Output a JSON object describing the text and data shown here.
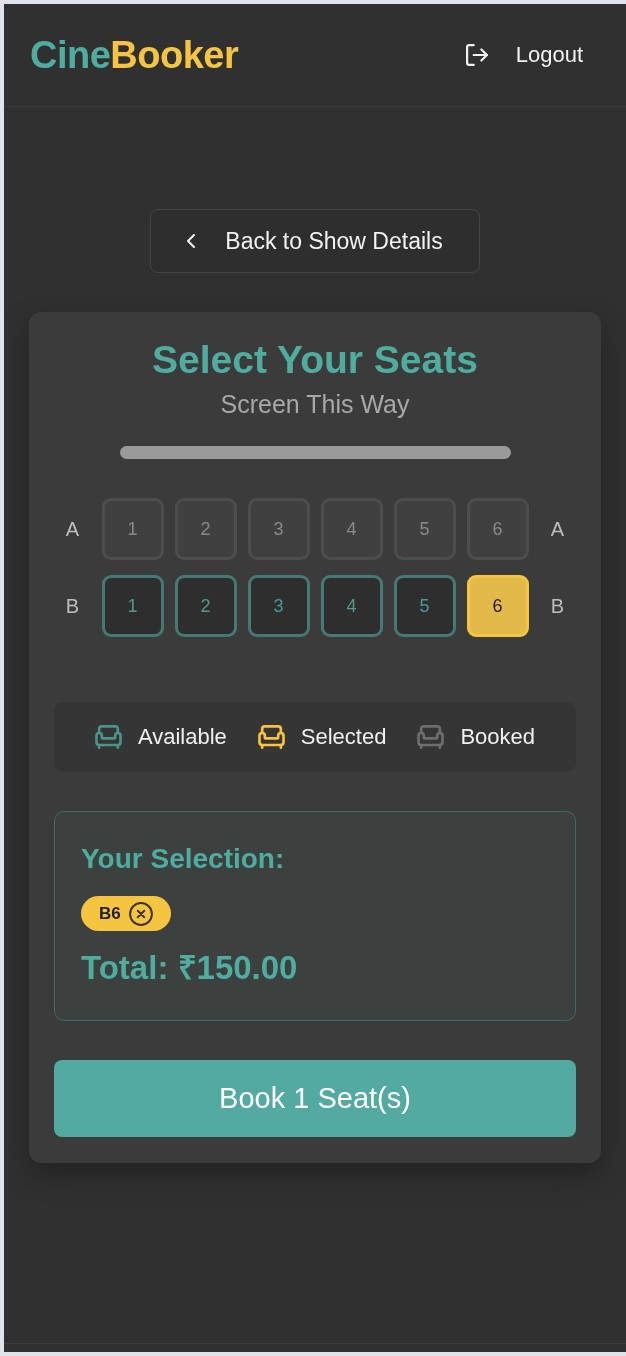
{
  "header": {
    "logo_part_1": "Cine",
    "logo_part_2": "Booker",
    "logout_label": "Logout"
  },
  "back_button": "Back to Show Details",
  "seat_picker": {
    "title": "Select Your Seats",
    "screen_label": "Screen This Way",
    "rows": [
      {
        "label_left": "A",
        "label_right": "A",
        "seats": [
          {
            "number": "1",
            "booked": true,
            "selected": false
          },
          {
            "number": "2",
            "booked": true,
            "selected": false
          },
          {
            "number": "3",
            "booked": true,
            "selected": false
          },
          {
            "number": "4",
            "booked": true,
            "selected": false
          },
          {
            "number": "5",
            "booked": true,
            "selected": false
          },
          {
            "number": "6",
            "booked": true,
            "selected": false
          }
        ]
      },
      {
        "label_left": "B",
        "label_right": "B",
        "seats": [
          {
            "number": "1",
            "booked": false,
            "selected": false
          },
          {
            "number": "2",
            "booked": false,
            "selected": false
          },
          {
            "number": "3",
            "booked": false,
            "selected": false
          },
          {
            "number": "4",
            "booked": false,
            "selected": false
          },
          {
            "number": "5",
            "booked": false,
            "selected": false
          },
          {
            "number": "6",
            "booked": false,
            "selected": true
          }
        ]
      }
    ],
    "legend": [
      {
        "kind": "available",
        "label": "Available"
      },
      {
        "kind": "selected",
        "label": "Selected"
      },
      {
        "kind": "booked",
        "label": "Booked"
      }
    ],
    "selection": {
      "heading": "Your Selection:",
      "seats": [
        {
          "label": "B6"
        }
      ],
      "total": "Total: ₹150.00"
    },
    "book_button": "Book 1 Seat(s)"
  }
}
